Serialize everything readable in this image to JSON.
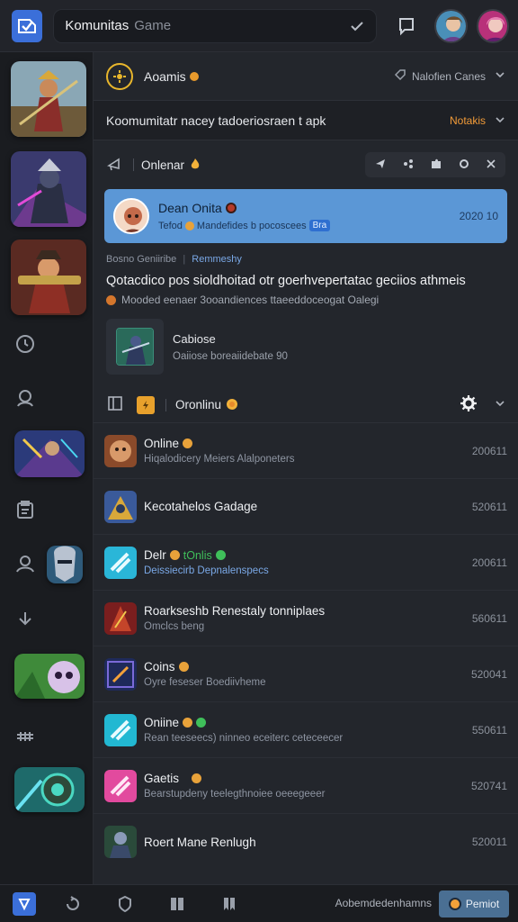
{
  "colors": {
    "accent": "#3b6fd9",
    "highlight": "#5b97d6",
    "gold": "#e8b62c",
    "orange": "#f29b38",
    "online_green": "#3fbf5a"
  },
  "header": {
    "brand": "Komunitas",
    "search_placeholder": "Game",
    "icons": [
      "app-logo-icon",
      "check-icon",
      "message-icon"
    ]
  },
  "section": {
    "name": "Aoamis",
    "filter_label": "Nalofien Canes"
  },
  "banner": {
    "text": "Koomumitatr nacey tadoeriosraen t apk",
    "action": "Notakis"
  },
  "thread": {
    "label": "Onlenar"
  },
  "highlight": {
    "name": "Dean Onita",
    "subtitle": "Tefod",
    "subtitle_rest": "Mandefides b pocoscees",
    "chip": "Bra",
    "time": "2020 10"
  },
  "meta": {
    "left": "Bosno Geniiribe",
    "right": "Remmeshy"
  },
  "post": {
    "title": "Qotacdico pos sioldhoitad otr goerhvepertatac geciios athmeis",
    "subtitle": "Mooded eenaer 3ooandiences ttaeeddoceogat Oalegi"
  },
  "card": {
    "title": "Cabiose",
    "subtitle": "Oaiiose boreaiidebate 90"
  },
  "list_header": {
    "label": "Oronlinu"
  },
  "list": [
    {
      "title": "Online",
      "badge": "orange",
      "subtitle": "Hiqalodicery Meiers Alalponeters",
      "time": "200611"
    },
    {
      "title": "Kecotahelos Gadage",
      "badge": "",
      "subtitle": "",
      "time": "520611"
    },
    {
      "title": "Delr",
      "badge": "orange",
      "tag": "tOnlis",
      "subtitle": "Deissiecirb Depnalenspecs",
      "time": "200611"
    },
    {
      "title": "Roarkseshb Renestaly tonniplaes",
      "badge": "",
      "subtitle": "Omclcs beng",
      "time": "560611"
    },
    {
      "title": "Coins",
      "badge": "orange",
      "subtitle": "Oyre feseser Boediivheme",
      "time": "520041"
    },
    {
      "title": "Oniine",
      "badge": "orange-green",
      "subtitle": "Rean teeseecs) ninneo eceiterc ceteceecer",
      "time": "550611"
    },
    {
      "title": "Gaetis",
      "badge": "orange",
      "subtitle": "Bearstupdeny teelegthnoiee oeeegeeer",
      "time": "520741"
    },
    {
      "title": "Roert Mane Renlugh",
      "badge": "",
      "subtitle": "",
      "time": "520011"
    }
  ],
  "bottom": {
    "status": "Aobemdedenhamns",
    "button": "Pemiot"
  }
}
